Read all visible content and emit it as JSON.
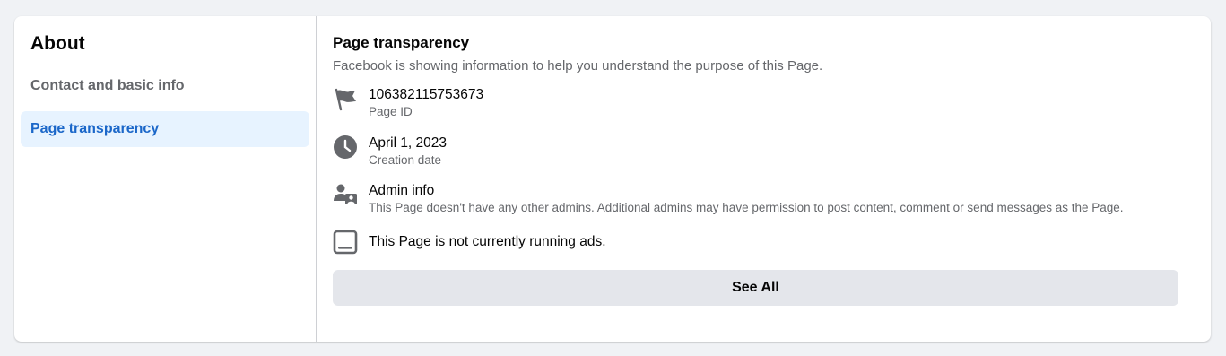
{
  "sidebar": {
    "title": "About",
    "items": [
      {
        "label": "Contact and basic info",
        "active": false
      },
      {
        "label": "Page transparency",
        "active": true
      }
    ]
  },
  "main": {
    "title": "Page transparency",
    "subtitle": "Facebook is showing information to help you understand the purpose of this Page.",
    "rows": [
      {
        "icon": "flag-icon",
        "primary": "106382115753673",
        "secondary": "Page ID"
      },
      {
        "icon": "clock-icon",
        "primary": "April 1, 2023",
        "secondary": "Creation date"
      },
      {
        "icon": "admin-icon",
        "primary": "Admin info",
        "secondary": "This Page doesn't have any other admins. Additional admins may have permission to post content, comment or send messages as the Page."
      },
      {
        "icon": "ads-icon",
        "primary": "This Page is not currently running ads.",
        "secondary": ""
      }
    ],
    "see_all_label": "See All"
  },
  "colors": {
    "background": "#f0f2f5",
    "card": "#ffffff",
    "active_nav_bg": "#e7f3ff",
    "active_nav_text": "#1b67c9",
    "secondary_text": "#65676b",
    "button_bg": "#e4e6eb",
    "icon": "#65676b"
  }
}
